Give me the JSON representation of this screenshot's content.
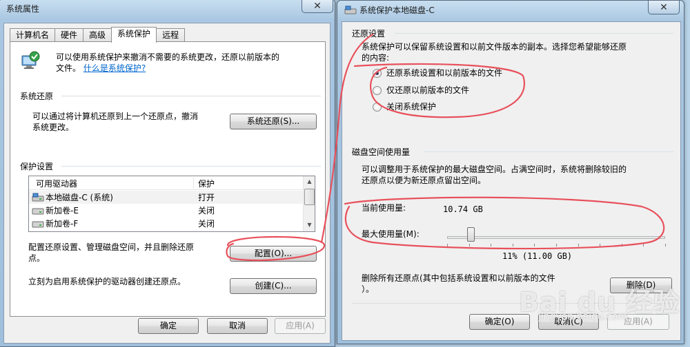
{
  "left_window": {
    "title": "系统属性",
    "close_glyph": "✕",
    "tabs": [
      "计算机名",
      "硬件",
      "高级",
      "系统保护",
      "远程"
    ],
    "active_tab": 3,
    "intro": {
      "text_line1": "可以使用系统保护来撤消不需要的系统更改，还原以前版本的",
      "text_line2_prefix": "文件。",
      "link": "什么是系统保护?"
    },
    "system_restore": {
      "heading": "系统还原",
      "desc_line1": "可以通过将计算机还原到上一个还原点，撤消",
      "desc_line2": "系统更改。",
      "button": "系统还原(S)..."
    },
    "protection": {
      "heading": "保护设置",
      "columns": [
        "可用驱动器",
        "保护"
      ],
      "rows": [
        {
          "drive": "本地磁盘-C (系统)",
          "status": "打开",
          "icon": "system-drive-icon"
        },
        {
          "drive": "新加卷-E",
          "status": "关闭",
          "icon": "drive-icon"
        },
        {
          "drive": "新加卷-F",
          "status": "关闭",
          "icon": "drive-icon"
        }
      ],
      "config_line1": "配置还原设置、管理磁盘空间，并且删除还原",
      "config_line2": "点。",
      "config_button": "配置(O)...",
      "create_text": "立刻为启用系统保护的驱动器创建还原点。",
      "create_button": "创建(C)..."
    },
    "footer": {
      "ok": "确定",
      "cancel": "取消",
      "apply": "应用(A)"
    }
  },
  "right_window": {
    "title": "系统保护本地磁盘-C",
    "close_glyph": "✕",
    "restore_settings": {
      "heading": "还原设置",
      "desc_line1": "系统保护可以保留系统设置和以前文件版本的副本。选择您希望能够还原",
      "desc_line2": "的内容:",
      "options": [
        {
          "label": "还原系统设置和以前版本的文件",
          "selected": true
        },
        {
          "label": "仅还原以前版本的文件",
          "selected": false
        },
        {
          "label": "关闭系统保护",
          "selected": false
        }
      ]
    },
    "disk_usage": {
      "heading": "磁盘空间使用量",
      "desc_line1": "可以调整用于系统保护的最大磁盘空间。占满空间时，系统将删除较旧的",
      "desc_line2": "还原点以便为新还原点留出空间。",
      "current_label": "当前使用量:",
      "current_value": "10.74 GB",
      "max_label": "最大使用量(M):",
      "max_percent": 11,
      "max_value": "11% (11.00 GB)",
      "delete_line1": "删除所有还原点(其中包括系统设置和以前版本的文件",
      "delete_line2": "）。",
      "delete_button": "删除(D)"
    },
    "footer": {
      "ok": "确定(O)",
      "cancel": "取消(C)",
      "apply": "应用(A)"
    }
  },
  "watermark": {
    "brand": "Bai du 经验",
    "url": "jingyan.baidu.com"
  },
  "colors": {
    "annotation": "#e8505b",
    "link": "#0066cc",
    "window_frame": "#a9c7e2"
  }
}
